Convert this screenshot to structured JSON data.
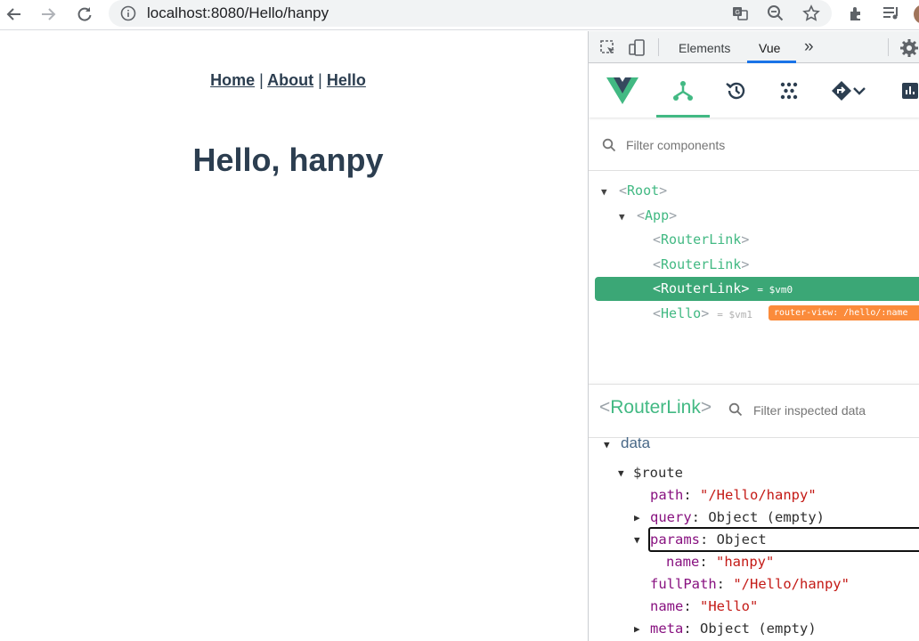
{
  "browser": {
    "url": "localhost:8080/Hello/hanpy",
    "icons": [
      "back-icon",
      "forward-icon",
      "reload-icon",
      "site-info-icon",
      "translate-icon",
      "zoom-icon",
      "bookmark-star-icon",
      "extensions-icon",
      "media-controls-icon",
      "avatar"
    ]
  },
  "page": {
    "nav": {
      "home": "Home",
      "about": "About",
      "hello": "Hello",
      "separator": "|"
    },
    "title": "Hello, hanpy"
  },
  "devtools": {
    "tabs": {
      "elements": "Elements",
      "vue": "Vue",
      "more": "»"
    },
    "filter_components_placeholder": "Filter components",
    "tree": {
      "root": "Root",
      "app": "App",
      "routerlink1": "RouterLink",
      "routerlink2": "RouterLink",
      "routerlink3": "RouterLink",
      "routerlink3_vm": "= $vm0",
      "hello": "Hello",
      "hello_vm": "= $vm1",
      "router_view_badge": "router-view: /hello/:name"
    },
    "inspector": {
      "component_name": "RouterLink",
      "filter_placeholder": "Filter inspected data",
      "section": "data",
      "route_key": "$route",
      "path_key": "path",
      "path_value": "\"/Hello/hanpy\"",
      "query_key": "query",
      "query_value": "Object (empty)",
      "params_key": "params",
      "params_value": "Object",
      "name_key": "name",
      "name_value": "\"hanpy\"",
      "fullpath_key": "fullPath",
      "fullpath_value": "\"/Hello/hanpy\"",
      "routename_key": "name",
      "routename_value": "\"Hello\"",
      "meta_key": "meta",
      "meta_value": "Object (empty)"
    }
  },
  "colors": {
    "vue_green": "#42b983",
    "selected": "#3ba776",
    "badge": "#fb8b3b",
    "key": "#881280",
    "string": "#c41a16"
  }
}
